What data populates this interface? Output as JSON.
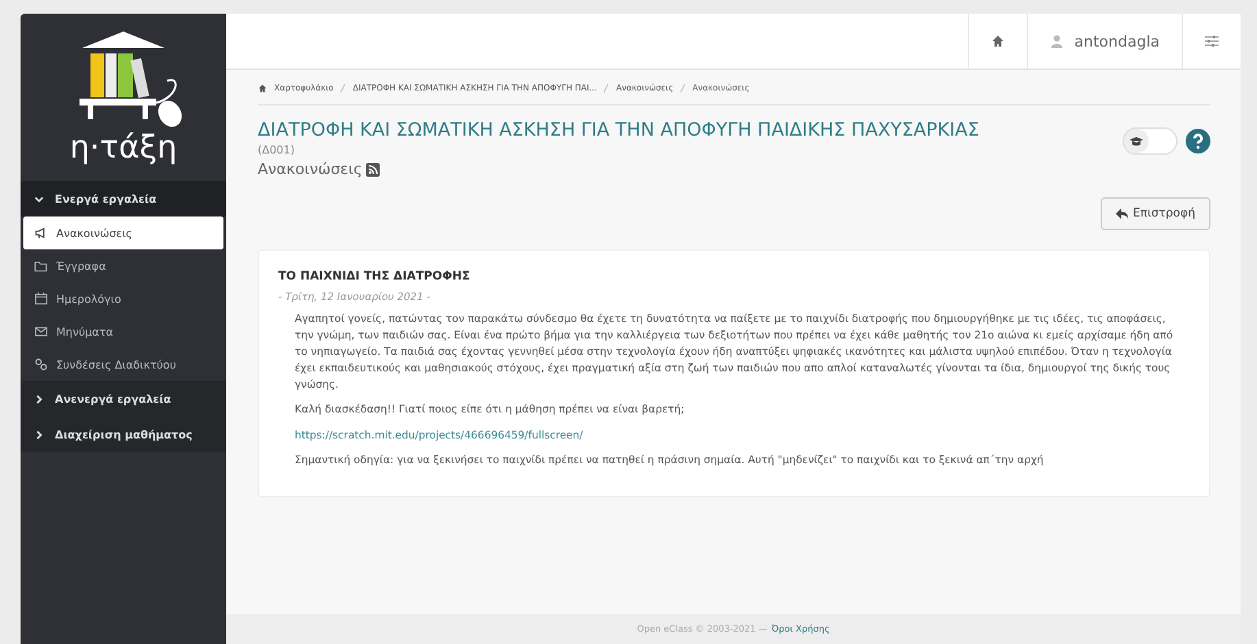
{
  "logo": {
    "text": "η·τάξη"
  },
  "topbar": {
    "username": "antondagla"
  },
  "sidebar": {
    "groups": [
      {
        "label": "Ενεργά εργαλεία",
        "expanded": true,
        "items": [
          {
            "label": "Ανακοινώσεις",
            "selected": true
          },
          {
            "label": "Έγγραφα",
            "selected": false
          },
          {
            "label": "Ημερολόγιο",
            "selected": false
          },
          {
            "label": "Μηνύματα",
            "selected": false
          },
          {
            "label": "Συνδέσεις Διαδικτύου",
            "selected": false
          }
        ]
      },
      {
        "label": "Ανενεργά εργαλεία",
        "expanded": false
      },
      {
        "label": "Διαχείριση μαθήματος",
        "expanded": false
      }
    ]
  },
  "breadcrumb": [
    "Χαρτοφυλάκιο",
    "ΔΙΑΤΡΟΦΗ ΚΑΙ ΣΩΜΑΤΙΚΗ ΑΣΚΗΣΗ ΓΙΑ ΤΗΝ ΑΠΟΦΥΓΗ ΠΑΙ...",
    "Ανακοινώσεις",
    "Ανακοινώσεις"
  ],
  "course": {
    "title": "ΔΙΑΤΡΟΦΗ ΚΑΙ ΣΩΜΑΤΙΚΗ ΑΣΚΗΣΗ ΓΙΑ ΤΗΝ ΑΠΟΦΥΓΗ ΠΑΙΔΙΚΗΣ ΠΑΧΥΣΑΡΚΙΑΣ",
    "code": "(Δ001)",
    "section": "Ανακοινώσεις",
    "toggle_on": false
  },
  "back_button": "Επιστροφή",
  "announcement": {
    "title": "ΤΟ ΠΑΙΧΝΙΔΙ ΤΗΣ ΔΙΑΤΡΟΦΗΣ",
    "date": "- Τρίτη, 12 Ιανουαρίου 2021 -",
    "paragraphs": [
      {
        "kind": "text",
        "text": "Αγαπητοί γονείς, πατώντας τον παρακάτω σύνδεσμο θα έχετε τη δυνατότητα να παίξετε με το παιχνίδι διατροφής που δημιουργήθηκε με τις ιδέες, τις αποφάσεις, την γνώμη, των παιδιών σας. Είναι ένα πρώτο βήμα για την καλλιέργεια των δεξιοτήτων που πρέπει να έχει κάθε μαθητής τον 21ο αιώνα κι εμείς αρχίσαμε ήδη από το νηπιαγωγείο. Τα παιδιά σας έχοντας γεννηθεί μέσα στην τεχνολογία έχουν ήδη αναπτύξει ψηφιακές ικανότητες και μάλιστα υψηλού επιπέδου. Όταν  η τεχνολογία έχει εκπαιδευτικούς και μαθησιακούς στόχους, έχει πραγματική αξία στη ζωή των παιδιών που απο απλοί καταναλωτές γίνονται τα ίδια, δημιουργοί της δικής τους γνώσης."
      },
      {
        "kind": "text",
        "text": "Καλή διασκέδαση!! Γιατί ποιος είπε ότι η μάθηση πρέπει να είναι βαρετή;"
      },
      {
        "kind": "link",
        "text": "https://scratch.mit.edu/projects/466696459/fullscreen/"
      },
      {
        "kind": "text",
        "text": "Σημαντική οδηγία: για να ξεκινήσει το παιχνίδι πρέπει να πατηθεί η πράσινη σημαία. Αυτή \"μηδενίζει\" το παιχνίδι και το ξεκινά απ΄την αρχή"
      }
    ]
  },
  "footer": {
    "text": "Open eClass © 2003-2021 —",
    "link": "Όροι Χρήσης"
  }
}
